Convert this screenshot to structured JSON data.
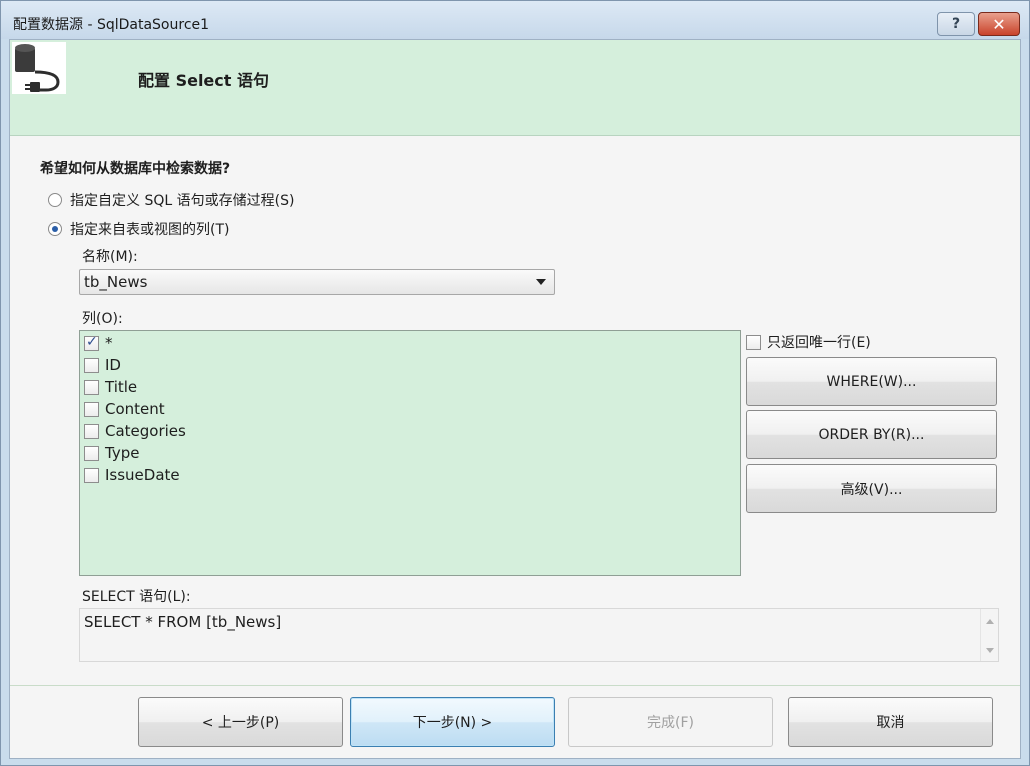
{
  "window": {
    "title": "配置数据源 - SqlDataSource1",
    "help_label": "?",
    "close_label": "✕"
  },
  "header": {
    "icon": "database-connection-icon",
    "title": "配置 Select 语句"
  },
  "question": "希望如何从数据库中检索数据?",
  "options": {
    "custom_sql": "指定自定义 SQL 语句或存储过程(S)",
    "table_columns": "指定来自表或视图的列(T)",
    "selected": "table_columns"
  },
  "name_field": {
    "label": "名称(M):",
    "value": "tb_News"
  },
  "columns": {
    "label": "列(O):",
    "items": [
      {
        "label": "*",
        "checked": true
      },
      {
        "label": "ID",
        "checked": false
      },
      {
        "label": "Title",
        "checked": false
      },
      {
        "label": "Content",
        "checked": false
      },
      {
        "label": "Categories",
        "checked": false
      },
      {
        "label": "Type",
        "checked": false
      },
      {
        "label": "IssueDate",
        "checked": false
      }
    ]
  },
  "side": {
    "unique_rows_label": "只返回唯一行(E)",
    "where_label": "WHERE(W)...",
    "order_by_label": "ORDER BY(R)...",
    "advanced_label": "高级(V)..."
  },
  "sql": {
    "label": "SELECT 语句(L):",
    "value": "SELECT * FROM [tb_News]"
  },
  "footer": {
    "prev_label": "< 上一步(P)",
    "next_label": "下一步(N) >",
    "finish_label": "完成(F)",
    "cancel_label": "取消"
  },
  "colors": {
    "header_bg": "#d5efdc",
    "columns_bg": "#d5efdc",
    "primary_border": "#3c7fb1"
  }
}
